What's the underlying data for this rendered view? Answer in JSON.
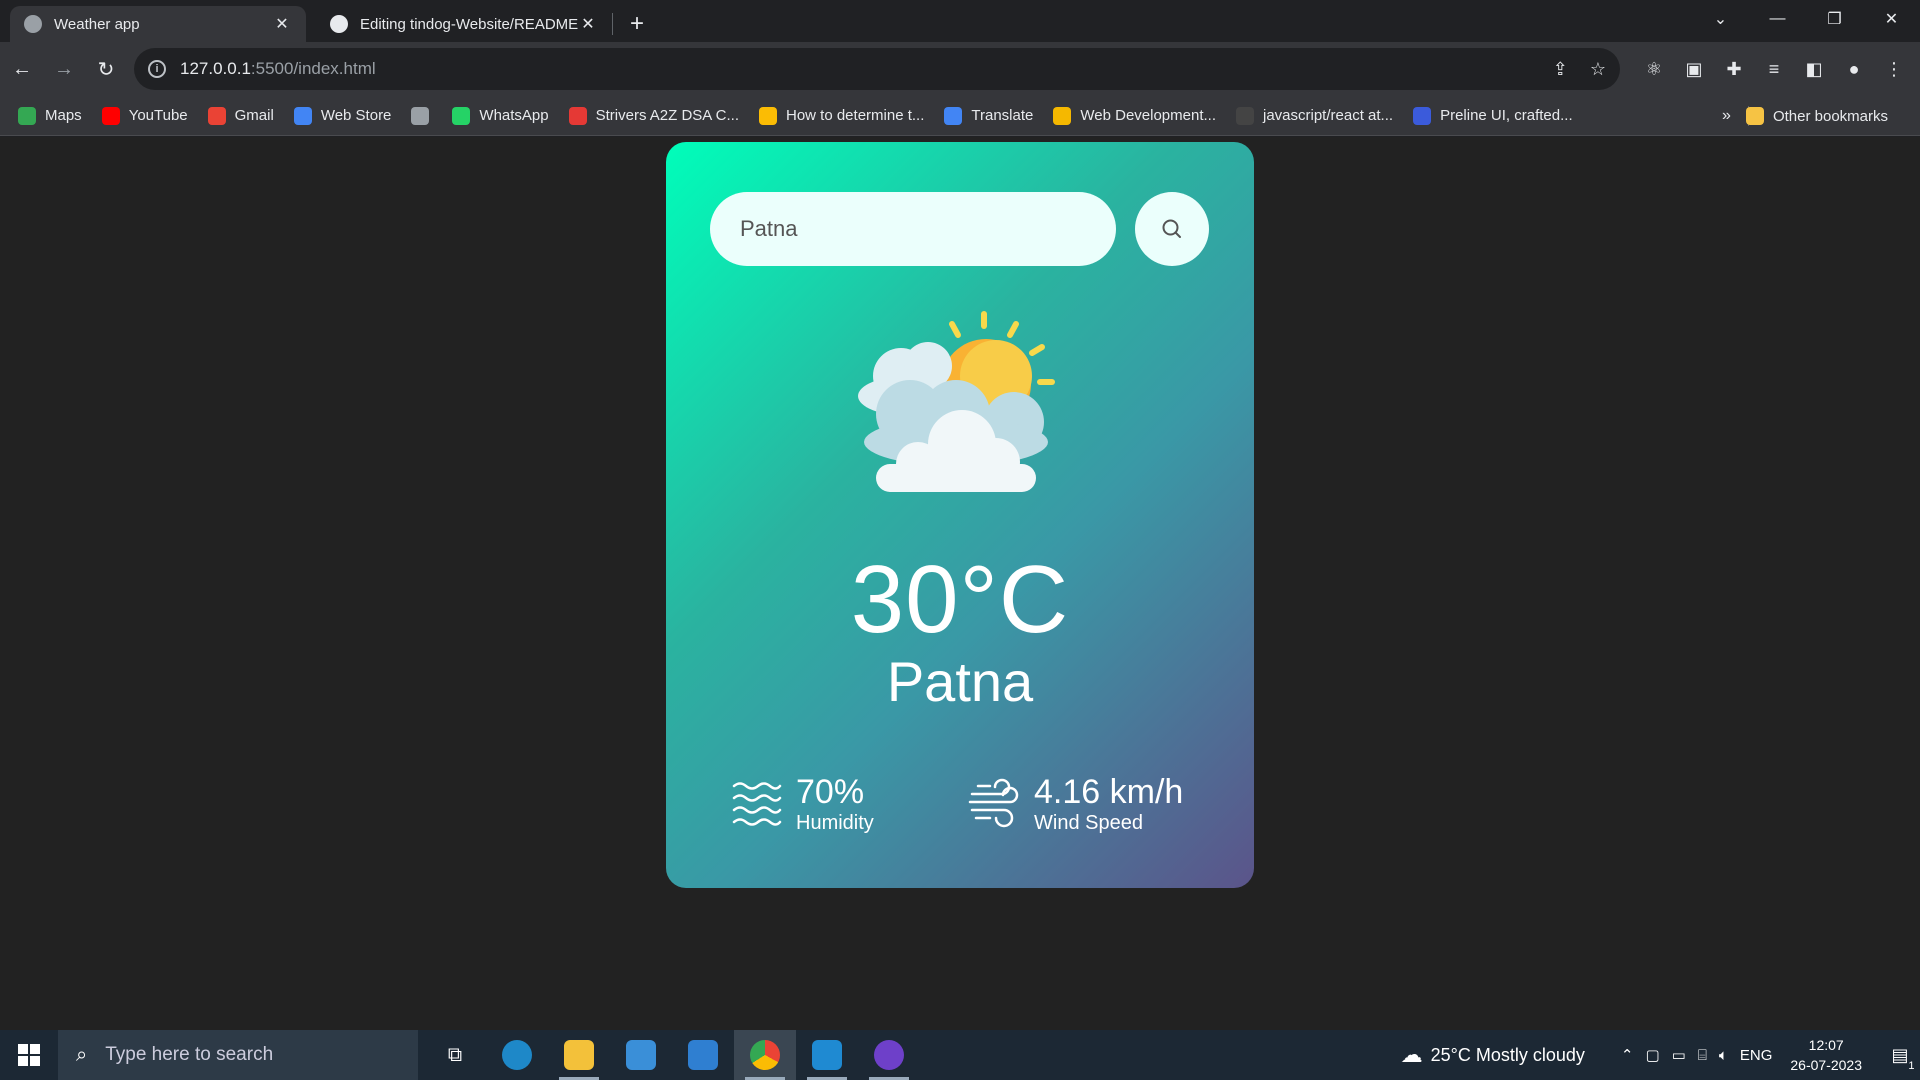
{
  "browser": {
    "tabs": [
      {
        "title": "Weather app",
        "active": true
      },
      {
        "title": "Editing tindog-Website/README",
        "active": false
      }
    ],
    "new_tab_label": "+",
    "url_host": "127.0.0.1",
    "url_path": ":5500/index.html",
    "bookmarks": [
      {
        "label": "Maps",
        "color": "#34a853"
      },
      {
        "label": "YouTube",
        "color": "#ff0000"
      },
      {
        "label": "Gmail",
        "color": "#ea4335"
      },
      {
        "label": "Web Store",
        "color": "#4285f4"
      },
      {
        "label": "",
        "color": "#9aa0a6"
      },
      {
        "label": "WhatsApp",
        "color": "#25d366"
      },
      {
        "label": "Strivers A2Z DSA C...",
        "color": "#e53935"
      },
      {
        "label": "How to determine t...",
        "color": "#fbbc04"
      },
      {
        "label": "Translate",
        "color": "#4285f4"
      },
      {
        "label": "Web Development...",
        "color": "#f5b800"
      },
      {
        "label": "javascript/react at...",
        "color": "#444"
      },
      {
        "label": "Preline UI, crafted...",
        "color": "#3b5bdb"
      }
    ],
    "more_bookmarks": "»",
    "other_bookmarks": "Other bookmarks"
  },
  "weather": {
    "search_value": "Patna",
    "icon": "partly-cloudy-sun-icon",
    "temperature": "30°C",
    "city": "Patna",
    "humidity_value": "70%",
    "humidity_label": "Humidity",
    "wind_value": "4.16 km/h",
    "wind_label": "Wind Speed"
  },
  "taskbar": {
    "search_placeholder": "Type here to search",
    "weather_text": "25°C  Mostly cloudy",
    "lang": "ENG",
    "time": "12:07",
    "date": "26-07-2023",
    "notification_count": "1"
  },
  "colors": {
    "card_gradient_start": "#00feba",
    "card_gradient_end": "#5b548a",
    "page_bg": "#222222"
  }
}
